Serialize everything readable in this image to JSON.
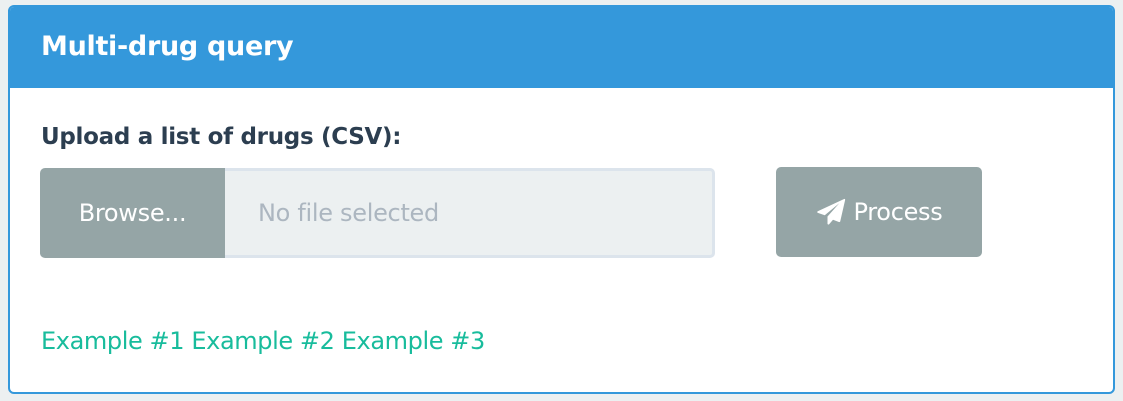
{
  "panel": {
    "title": "Multi-drug query",
    "accent_color": "#3498db"
  },
  "upload": {
    "label": "Upload a list of drugs (CSV):",
    "browse_label": "Browse...",
    "file_status": "No file selected"
  },
  "process_button": {
    "label": "Process",
    "icon": "paper-plane-icon"
  },
  "examples": [
    {
      "label": "Example #1"
    },
    {
      "label": "Example #2"
    },
    {
      "label": "Example #3"
    }
  ],
  "colors": {
    "button_gray": "#95a5a6",
    "link_green": "#18bc9c",
    "label_text": "#2c3e50"
  }
}
